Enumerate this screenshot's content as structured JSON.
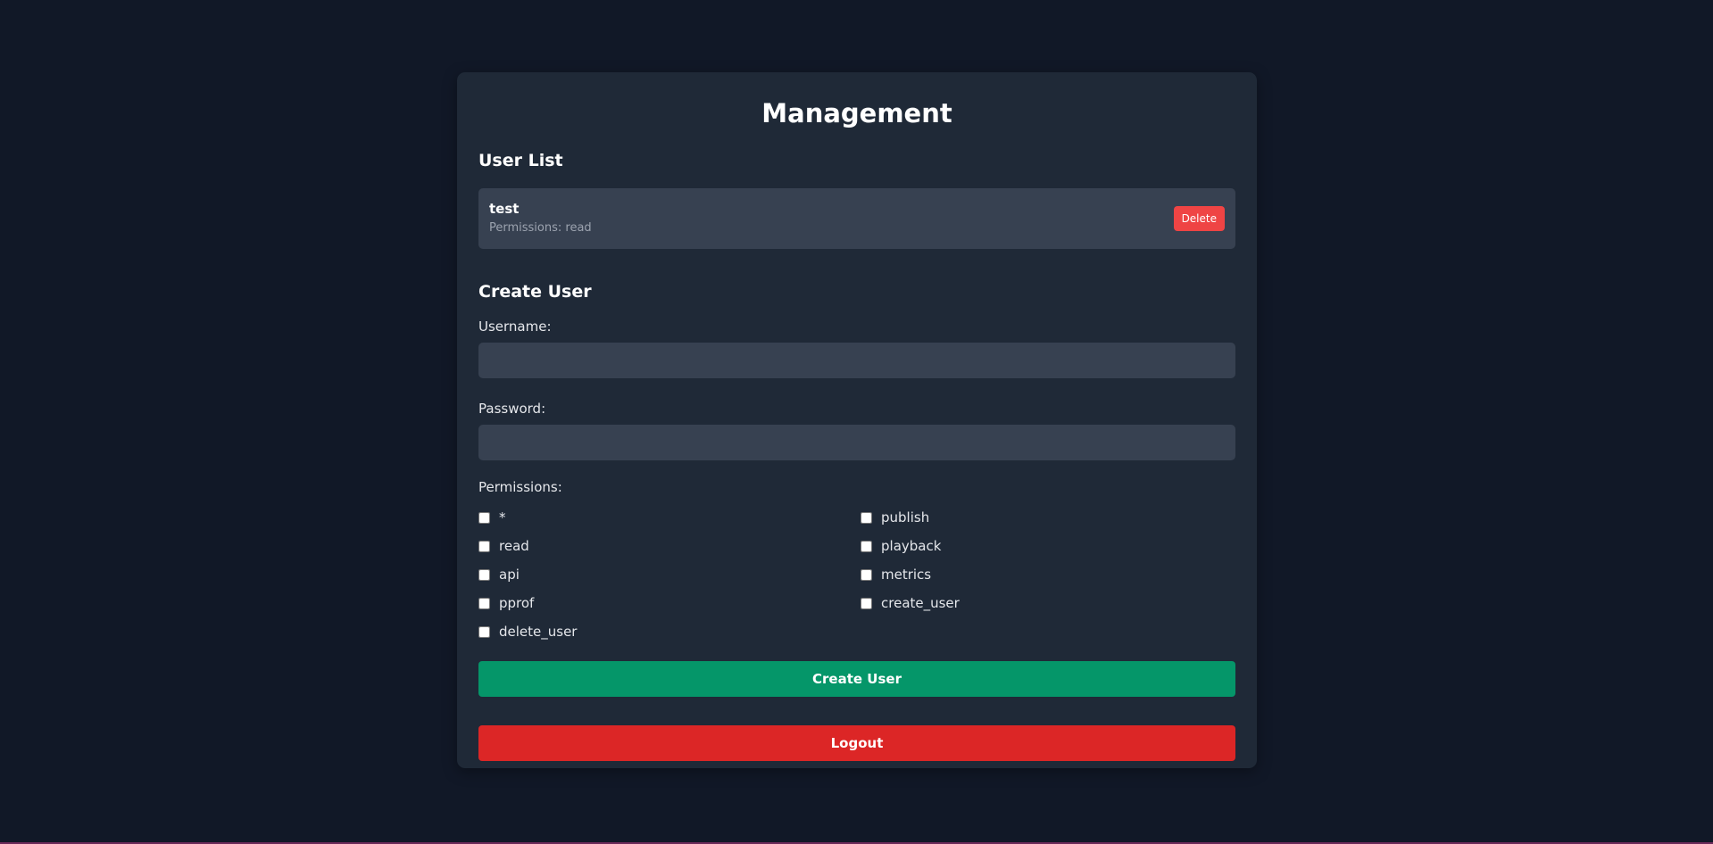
{
  "page": {
    "title": "Management"
  },
  "user_list": {
    "heading": "User List",
    "users": [
      {
        "name": "test",
        "permissions_text": "Permissions: read",
        "delete_label": "Delete"
      }
    ]
  },
  "create_user": {
    "heading": "Create User",
    "username_label": "Username:",
    "username_value": "",
    "password_label": "Password:",
    "password_value": "",
    "permissions_label": "Permissions:",
    "permissions": [
      {
        "name": "*",
        "checked": false
      },
      {
        "name": "publish",
        "checked": false
      },
      {
        "name": "read",
        "checked": false
      },
      {
        "name": "playback",
        "checked": false
      },
      {
        "name": "api",
        "checked": false
      },
      {
        "name": "metrics",
        "checked": false
      },
      {
        "name": "pprof",
        "checked": false
      },
      {
        "name": "create_user",
        "checked": false
      },
      {
        "name": "delete_user",
        "checked": false
      }
    ],
    "submit_label": "Create User"
  },
  "logout_label": "Logout",
  "colors": {
    "background": "#111827",
    "card": "#1f2937",
    "input": "#374151",
    "create_button": "#059669",
    "logout_button": "#dc2626",
    "delete_button": "#ef4444"
  }
}
